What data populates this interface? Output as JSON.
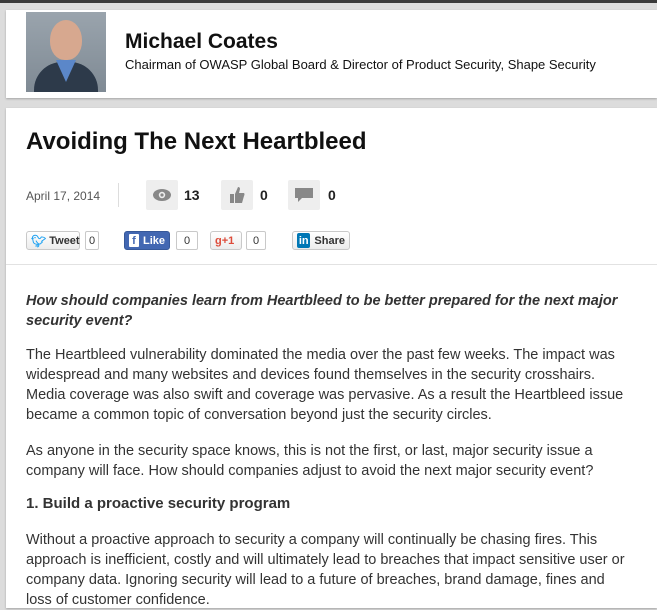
{
  "profile": {
    "name": "Michael Coates",
    "headline": "Chairman of OWASP Global Board & Director of Product Security, Shape Security"
  },
  "article": {
    "title": "Avoiding The Next Heartbleed",
    "date": "April 17, 2014",
    "stats": {
      "views": "13",
      "likes": "0",
      "comments": "0"
    },
    "share": {
      "tweet_label": "Tweet",
      "tweet_count": "0",
      "like_label": "Like",
      "like_count": "0",
      "gplus_label": "+1",
      "gplus_count": "0",
      "linkedin_label": "Share"
    },
    "intro": "How should companies learn from Heartbleed to be better prepared for the next major security event?",
    "paragraphs": [
      "The Heartbleed vulnerability dominated the media over the past few weeks. The impact was widespread and many websites and devices found themselves in the security crosshairs. Media coverage was also swift and coverage was pervasive. As a result the Heartbleed issue became a common topic of conversation beyond just the security circles.",
      "As anyone in the security space knows, this is not the first, or last, major security issue a company will face. How should companies adjust to avoid the next major security event?",
      "Without a proactive approach to security a company will continually be chasing fires. This approach is inefficient, costly and will ultimately lead to breaches that impact sensitive user or company data. Ignoring security will lead to a future of breaches, brand damage, fines and loss of customer confidence."
    ],
    "section_heading": "1. Build a proactive security program"
  },
  "colors": {
    "facebook": "#4267b2",
    "twitter": "#1da1f2",
    "gplus": "#dd4b39",
    "linkedin": "#0077b5"
  }
}
